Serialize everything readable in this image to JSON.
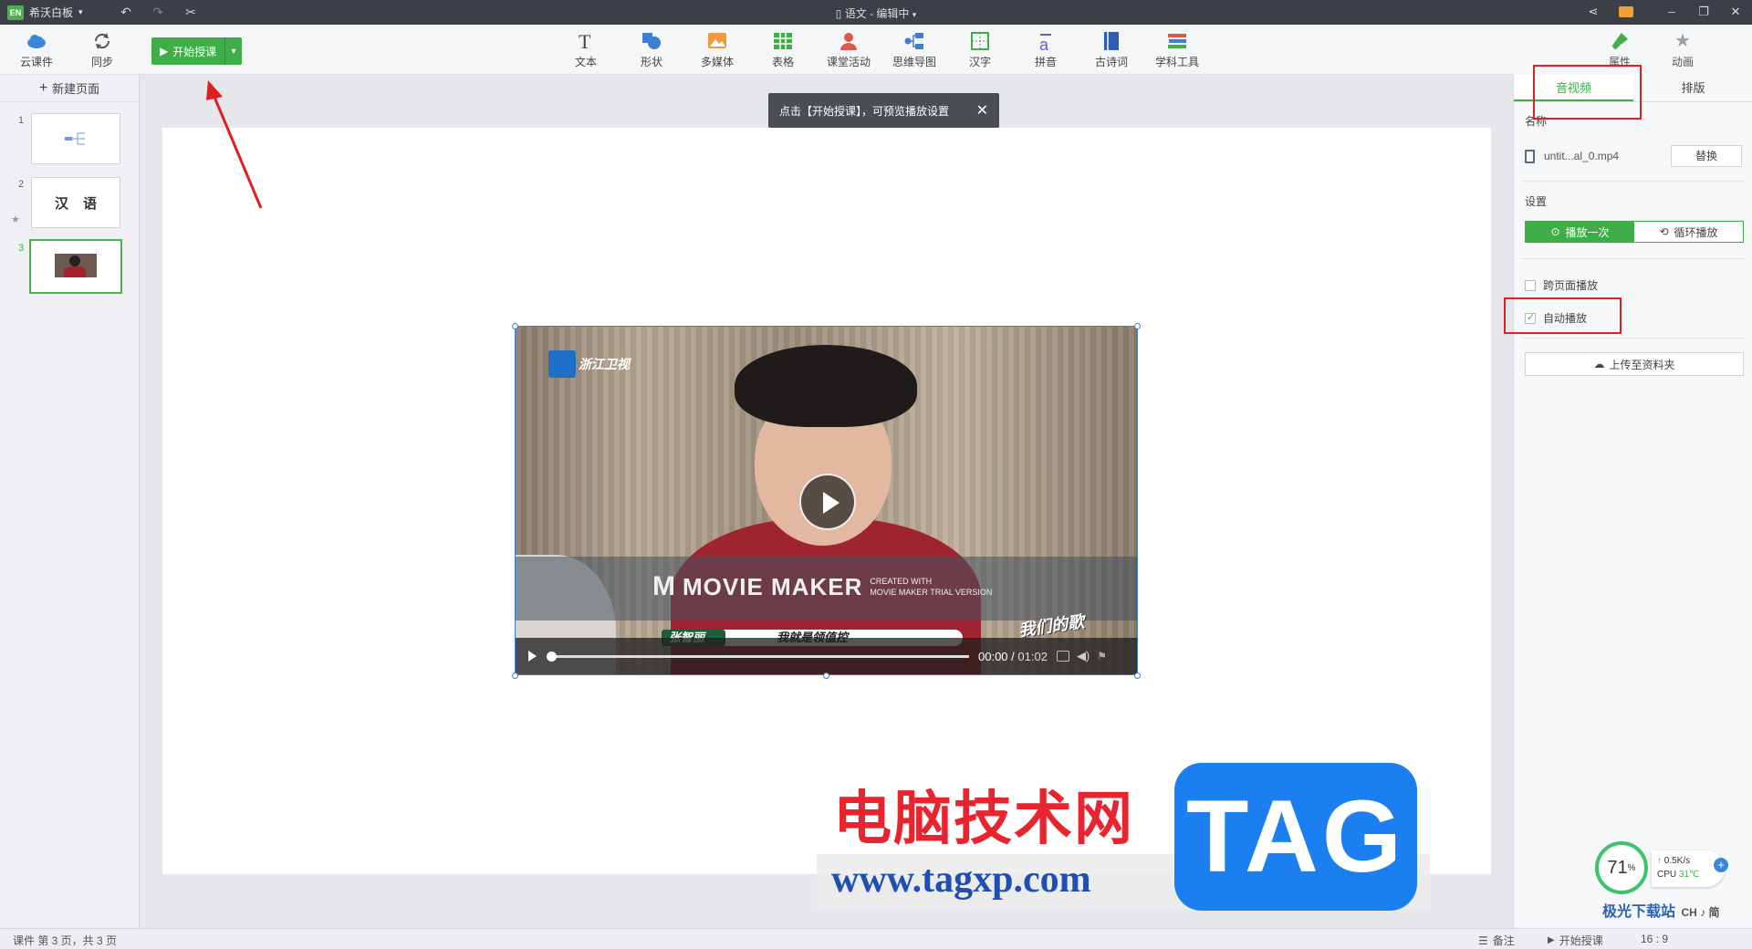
{
  "titlebar": {
    "app_logo": "EN",
    "app_name": "希沃白板",
    "doc_title": "语文 - 编辑中"
  },
  "toolbar": {
    "cloud_label": "云课件",
    "sync_label": "同步",
    "start_label": "开始授课",
    "tools": [
      "文本",
      "形状",
      "多媒体",
      "表格",
      "课堂活动",
      "思维导图",
      "汉字",
      "拼音",
      "古诗词",
      "学科工具"
    ],
    "props_label": "属性",
    "anim_label": "动画"
  },
  "pages": {
    "new_page_label": "新建页面",
    "items": [
      {
        "num": "1"
      },
      {
        "num": "2",
        "chars": [
          "汉",
          "语"
        ]
      },
      {
        "num": "3"
      }
    ]
  },
  "tooltip": {
    "text": "点击【开始授课】，可预览播放设置"
  },
  "video": {
    "channel": "浙江卫视",
    "watermark_title": "MOVIE MAKER",
    "watermark_sub1": "CREATED WITH",
    "watermark_sub2": "MOVIE MAKER TRIAL VERSION",
    "name_tag": "张智丽",
    "subtitle": "我就是领值控",
    "show_logo": "我们的歌",
    "current_time": "00:00",
    "duration": "01:02",
    "progress": 0
  },
  "panel": {
    "tabs": [
      {
        "label": "音视频",
        "active": true
      },
      {
        "label": "排版",
        "active": false
      }
    ],
    "name_label": "名称",
    "file_name": "untit...al_0.mp4",
    "replace_label": "替换",
    "settings_label": "设置",
    "play_once": "播放一次",
    "loop_play": "循环播放",
    "cross_page": "跨页面播放",
    "auto_play": "自动播放",
    "upload_label": "上传至资料夹"
  },
  "site_watermark": {
    "cn": "电脑技术网",
    "url": "www.tagxp.com",
    "tag": "TAG"
  },
  "perf": {
    "percent": "71",
    "unit": "%",
    "speed": "0.5K/s",
    "cpu": "CPU",
    "temp": "31℃"
  },
  "statusbar": {
    "page_info": "课件 第 3 页，共 3 页",
    "notes": "备注",
    "start": "开始授课",
    "ratio": "16 : 9"
  },
  "corner_logo": {
    "name": "极光下载站",
    "sub": "CH ♪ 简"
  },
  "colors": {
    "accent": "#3fae49",
    "titlebar": "#3c3f45",
    "annotation": "#e02020"
  }
}
